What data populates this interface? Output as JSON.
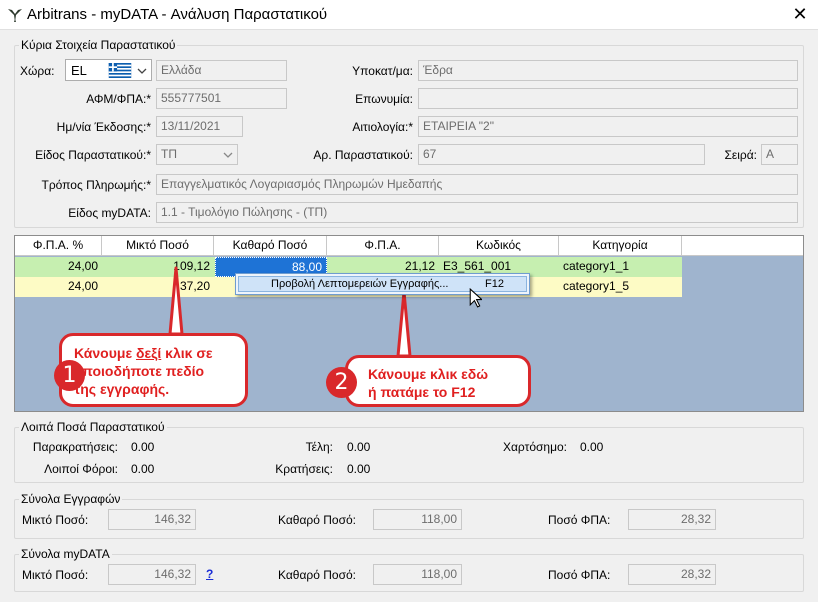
{
  "window": {
    "title": "Arbitrans - myDATA - Ανάλυση Παραστατικού",
    "close_glyph": "✕"
  },
  "main_info": {
    "title": "Κύρια Στοιχεία Παραστατικού",
    "country_label": "Χώρα:",
    "country_code": "EL",
    "country_name": "Ελλάδα",
    "vat_label": "ΑΦΜ/ΦΠΑ:*",
    "vat_value": "555777501",
    "issue_date_label": "Ημ/νία Έκδοσης:*",
    "issue_date_value": "13/11/2021",
    "doc_type_label": "Είδος Παραστατικού:*",
    "doc_type_value": "ΤΠ",
    "payment_label": "Τρόπος Πληρωμής:*",
    "payment_value": "Επαγγελματικός Λογαριασμός Πληρωμών Ημεδαπής",
    "mydata_type_label": "Είδος myDATA:",
    "mydata_type_value": "1.1 - Τιμολόγιο Πώλησης - (ΤΠ)",
    "branch_label": "Υποκατ/μα:",
    "branch_value": "Έδρα",
    "name_label": "Επωνυμία:",
    "name_value": "",
    "reason_label": "Αιτιολογία:*",
    "reason_value": "ΕΤΑΙΡΕΙΑ \"2\"",
    "doc_number_label": "Αρ. Παραστατικού:",
    "doc_number_value": "67",
    "series_label": "Σειρά:",
    "series_value": "Α"
  },
  "grid": {
    "columns": [
      "Φ.Π.Α. %",
      "Μικτό Ποσό",
      "Καθαρό Ποσό",
      "Φ.Π.Α.",
      "Κωδικός",
      "Κατηγορία"
    ],
    "rows": [
      {
        "vat_pct": "24,00",
        "gross": "109,12",
        "net": "88,00",
        "vat": "21,12",
        "code": "E3_561_001",
        "category": "category1_1"
      },
      {
        "vat_pct": "24,00",
        "gross": "37,20",
        "net": "",
        "vat": "",
        "code": "",
        "category": "category1_5"
      }
    ]
  },
  "context_menu": {
    "item_label": "Προβολή Λεπτομερειών Εγγραφής...",
    "shortcut": "F12"
  },
  "callouts": [
    {
      "number": "1",
      "line1_pre": "Κάνουμε ",
      "line1_em": "δεξί",
      "line1_post": " κλικ σε",
      "line2": "οποιοδήποτε πεδίο",
      "line3": "της εγγραφής."
    },
    {
      "number": "2",
      "line1": "Κάνουμε κλικ εδώ",
      "line2": "ή πατάμε το F12"
    }
  ],
  "other_amounts": {
    "title": "Λοιπά Ποσά Παραστατικού",
    "withholdings_label": "Παρακρατήσεις:",
    "withholdings_value": "0.00",
    "fees_label": "Τέλη:",
    "fees_value": "0.00",
    "stamp_label": "Χαρτόσημο:",
    "stamp_value": "0.00",
    "other_taxes_label": "Λοιποί Φόροι:",
    "other_taxes_value": "0.00",
    "deductions_label": "Κρατήσεις:",
    "deductions_value": "0.00"
  },
  "entry_totals": {
    "title": "Σύνολα Εγγραφών",
    "gross_label": "Μικτό Ποσό:",
    "gross_value": "146,32",
    "net_label": "Καθαρό Ποσό:",
    "net_value": "118,00",
    "vat_label": "Ποσό ΦΠΑ:",
    "vat_value": "28,32"
  },
  "mydata_totals": {
    "title": "Σύνολα myDATA",
    "gross_label": "Μικτό Ποσό:",
    "gross_value": "146,32",
    "help_link": "?",
    "net_label": "Καθαρό Ποσό:",
    "net_value": "118,00",
    "vat_label": "Ποσό ΦΠΑ:",
    "vat_value": "28,32"
  },
  "colors": {
    "row_green": "#c6efb0",
    "row_yellow": "#fdfbc5",
    "grid_bg": "#9fb4ce",
    "selection": "#1e73d6",
    "callout_red": "#d9282b",
    "greek_flag_blue": "#0d5eaf"
  },
  "icons": [
    "app-bird-icon",
    "close-icon",
    "greek-flag-icon",
    "chevron-down-icon",
    "mouse-cursor-icon"
  ]
}
